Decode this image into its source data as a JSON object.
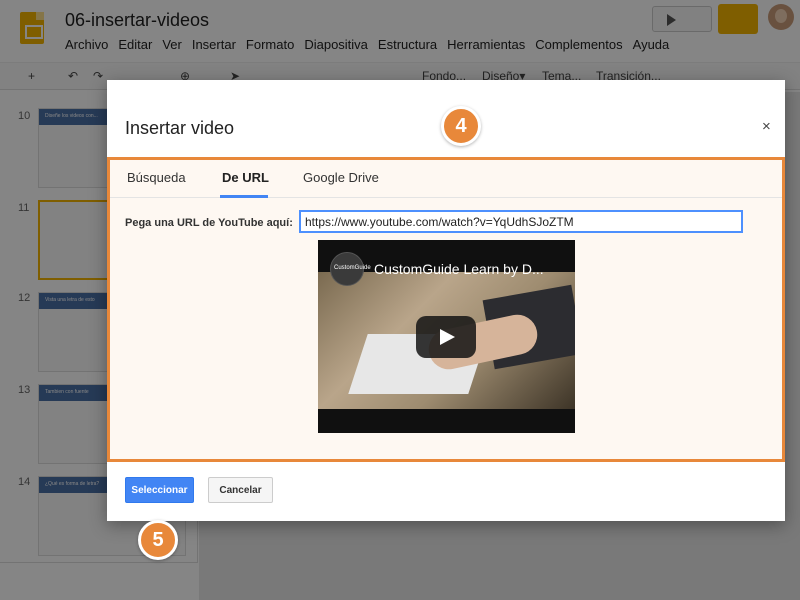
{
  "app": {
    "doc_title": "06-insertar-videos",
    "menu": [
      "Archivo",
      "Editar",
      "Ver",
      "Insertar",
      "Formato",
      "Diapositiva",
      "Estructura",
      "Herramientas",
      "Complementos",
      "Ayuda"
    ],
    "toolbar": {
      "background_label": "Fondo...",
      "design_label": "Diseño▾",
      "theme_label": "Tema...",
      "transition_label": "Transición..."
    },
    "slides": [
      {
        "number": "10",
        "caption": "Diseñe los videos con..."
      },
      {
        "number": "11",
        "caption": ""
      },
      {
        "number": "12",
        "caption": "Vista una letra de esto"
      },
      {
        "number": "13",
        "caption": "Tambien con fuente"
      },
      {
        "number": "14",
        "caption": "¿Qué es forma de letra?"
      }
    ]
  },
  "dialog": {
    "title": "Insertar video",
    "close_icon": "×",
    "tabs": [
      "Búsqueda",
      "De URL",
      "Google Drive"
    ],
    "active_tab": "De URL",
    "url_label": "Pega una URL de YouTube aquí:",
    "url_value": "https://www.youtube.com/watch?v=YqUdhSJoZTM",
    "video": {
      "title": "CustomGuide Learn by D...",
      "channel_logo_text": "CustomGuide"
    },
    "select_label": "Seleccionar",
    "cancel_label": "Cancelar"
  },
  "annotations": {
    "step_4": "4",
    "step_5": "5",
    "highlight_color": "#e8883a"
  },
  "colors": {
    "primary_button": "#4285f4",
    "tab_underline": "#4285f4",
    "slides_brand": "#f4b400"
  }
}
